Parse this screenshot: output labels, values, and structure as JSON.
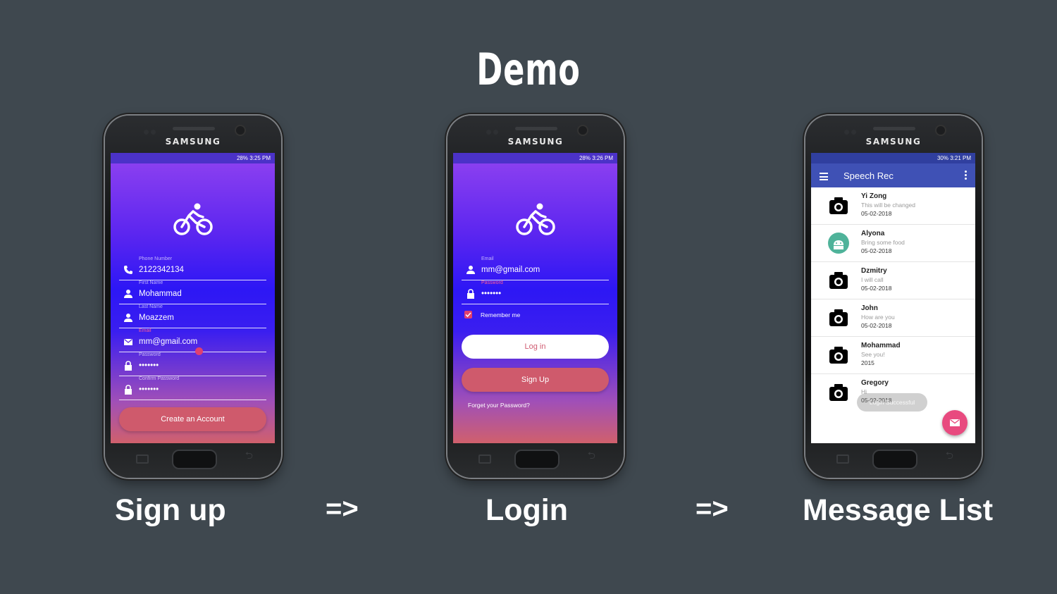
{
  "title": "Demo",
  "captions": {
    "signup": "Sign up",
    "arrow1": "=>",
    "login": "Login",
    "arrow2": "=>",
    "messages": "Message List"
  },
  "brand": "SAMSUNG",
  "signup": {
    "status": "28% 3:25 PM",
    "fields": [
      {
        "label": "Phone Number",
        "value": "2122342134",
        "icon": "phone-icon"
      },
      {
        "label": "First Name",
        "value": "Mohammad",
        "icon": "person-icon"
      },
      {
        "label": "Last Name",
        "value": "Moazzem",
        "icon": "person-icon"
      },
      {
        "label": "Email",
        "value": "mm@gmail.com",
        "icon": "email-icon"
      },
      {
        "label": "Password",
        "value": "•••••••",
        "icon": "lock-icon"
      },
      {
        "label": "Confirm Password",
        "value": "•••••••",
        "icon": "lock-icon"
      }
    ],
    "button": "Create an Account"
  },
  "login": {
    "status": "28% 3:26 PM",
    "email_label": "Email",
    "email_value": "mm@gmail.com",
    "password_label": "Password",
    "password_value": "•••••••",
    "remember": "Remember me",
    "login_button": "Log in",
    "signup_button": "Sign Up",
    "forgot": "Forget your Password?"
  },
  "messages": {
    "status": "30% 3:21 PM",
    "app_title": "Speech Rec",
    "items": [
      {
        "name": "Yi Zong",
        "message": "This will be changed",
        "date": "05-02-2018",
        "icon": "camera-icon"
      },
      {
        "name": "Alyona",
        "message": "Bring some food",
        "date": "05-02-2018",
        "icon": "android-icon"
      },
      {
        "name": "Dzmitry",
        "message": "I will call",
        "date": "05-02-2018",
        "icon": "camera-icon"
      },
      {
        "name": "John",
        "message": "How are you",
        "date": "05-02-2018",
        "icon": "camera-icon"
      },
      {
        "name": "Mohammad",
        "message": "See you!",
        "date": "2015",
        "icon": "camera-icon"
      },
      {
        "name": "Gregory",
        "message": "Hi",
        "date": "05-02-2018",
        "icon": "camera-icon"
      }
    ],
    "toast": "Login Successful"
  },
  "colors": {
    "background": "#3f484f",
    "accent_pink": "#cf5a6c",
    "toolbar": "#3f51b5",
    "fab": "#e84a7f"
  }
}
